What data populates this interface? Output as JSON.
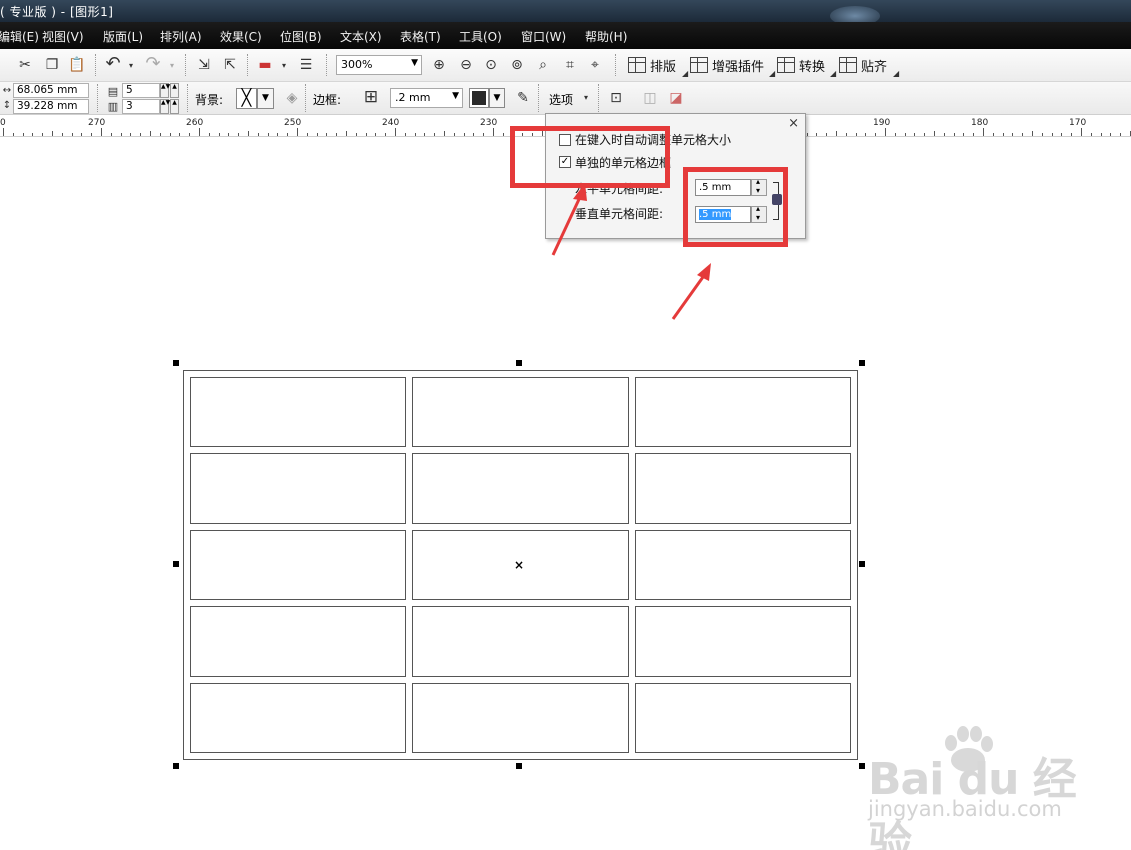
{
  "titlebar": {
    "title": "( 专业版 ) - [图形1]"
  },
  "menu": [
    "编辑(E)",
    "视图(V)",
    "版面(L)",
    "排列(A)",
    "效果(C)",
    "位图(B)",
    "文本(X)",
    "表格(T)",
    "工具(O)",
    "窗口(W)",
    "帮助(H)"
  ],
  "toolbar": {
    "zoom": "300%",
    "buttons": {
      "layout": "排版",
      "plugins": "增强插件",
      "convert": "转换",
      "align": "贴齐"
    }
  },
  "propbar": {
    "width": "68.065 mm",
    "height": "39.228 mm",
    "rows": "5",
    "cols": "3",
    "background_label": "背景:",
    "border_label": "边框:",
    "border_width": ".2 mm",
    "options_label": "选项"
  },
  "ruler": {
    "labels": [
      "0",
      "270",
      "260",
      "250",
      "240",
      "230",
      "190",
      "180",
      "170"
    ]
  },
  "popup": {
    "close": "×",
    "auto_resize_label": "在键入时自动调整单元格大小",
    "separate_borders_label": "单独的单元格边框",
    "separate_borders_checked": true,
    "h_spacing_label": "水平单元格间距:",
    "h_spacing_value": ".5 mm",
    "v_spacing_label": "垂直单元格间距:",
    "v_spacing_value": ".5 mm"
  },
  "table": {
    "rows": 5,
    "cols": 3
  },
  "watermark": {
    "brand": "Bai du 经验",
    "url": "jingyan.baidu.com"
  },
  "colors": {
    "highlight": "#e53a3a",
    "selection": "#3399ff",
    "menubar": "#0a0a0a"
  }
}
